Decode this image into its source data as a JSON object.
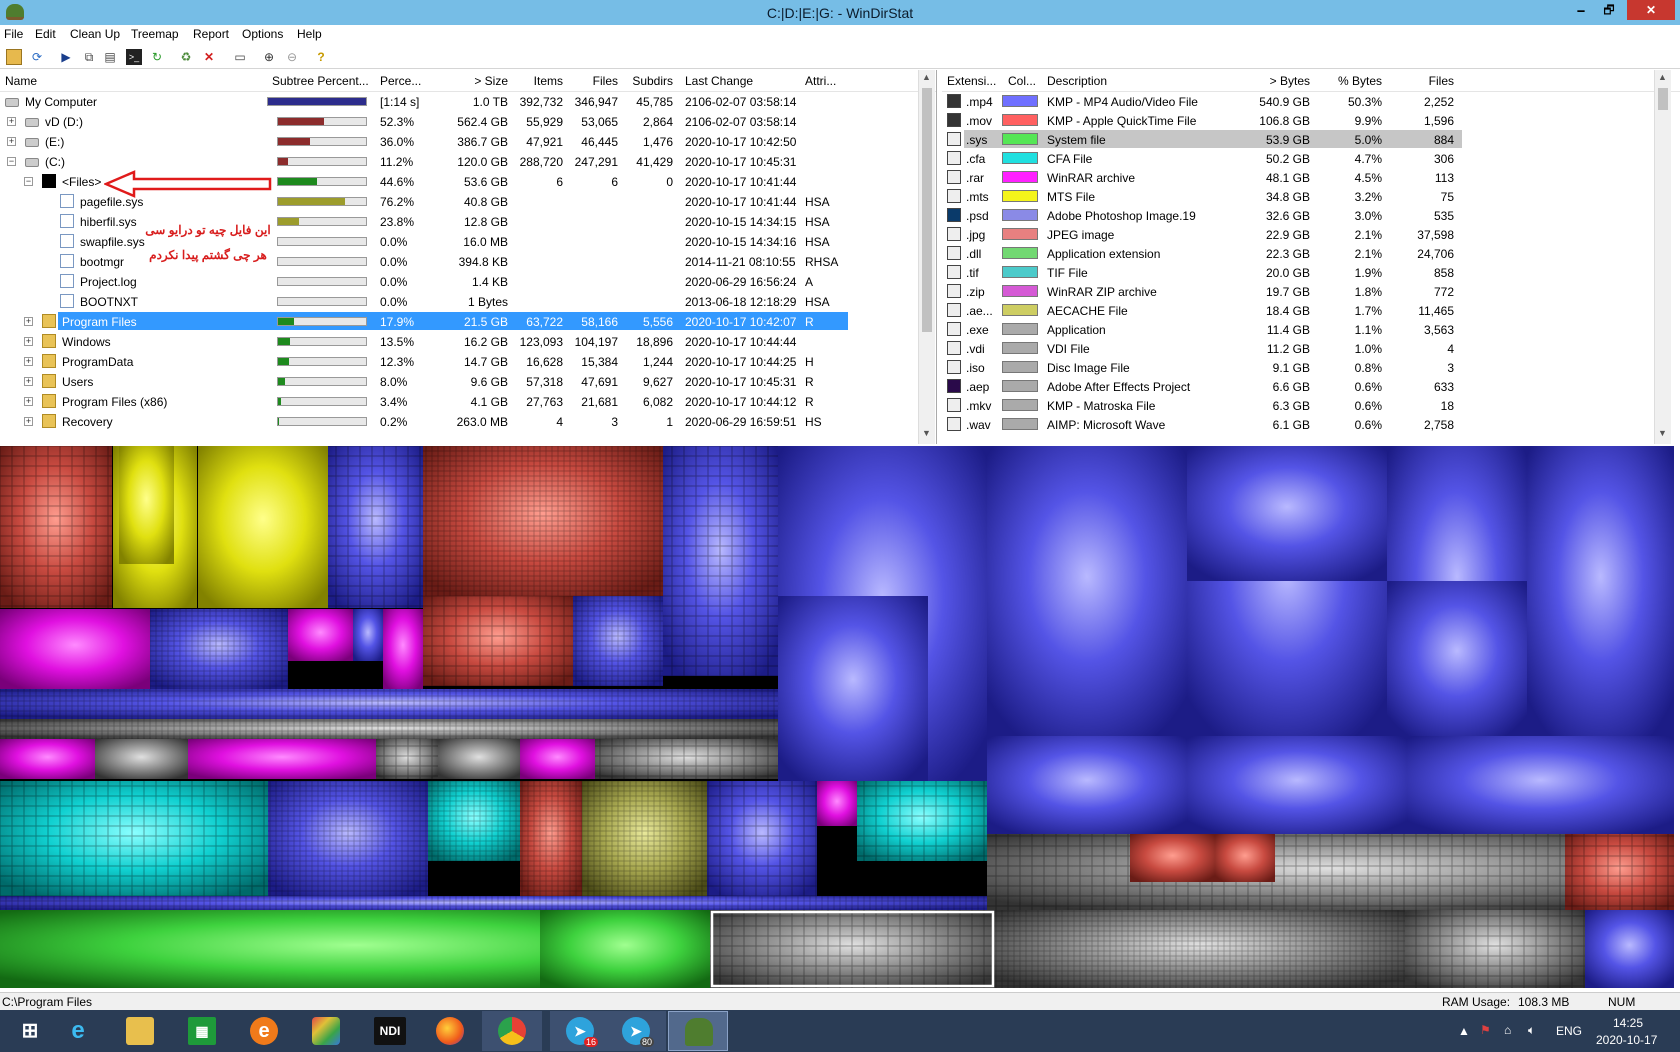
{
  "window": {
    "title": "C:|D:|E:|G: - WinDirStat",
    "min": "🗕",
    "max": "🗗",
    "close": "✕"
  },
  "menu": [
    "File",
    "Edit",
    "Clean Up",
    "Treemap",
    "Report",
    "Options",
    "Help"
  ],
  "tree": {
    "columns": [
      "Name",
      "Subtree Percent...",
      "Perce...",
      "> Size",
      "Items",
      "Files",
      "Subdirs",
      "Last Change",
      "Attri..."
    ],
    "rows": [
      {
        "name": "My Computer",
        "bar": 1.0,
        "pct": "[1:14 s]",
        "size": "1.0 TB",
        "items": "392,732",
        "files": "346,947",
        "subdirs": "45,785",
        "last": "2106-02-07 03:58:14",
        "attr": ""
      },
      {
        "name": "vD (D:)",
        "bar": 0.523,
        "pct": "52.3%",
        "size": "562.4 GB",
        "items": "55,929",
        "files": "53,065",
        "subdirs": "2,864",
        "last": "2106-02-07 03:58:14",
        "attr": ""
      },
      {
        "name": "(E:)",
        "bar": 0.36,
        "pct": "36.0%",
        "size": "386.7 GB",
        "items": "47,921",
        "files": "46,445",
        "subdirs": "1,476",
        "last": "2020-10-17 10:42:50",
        "attr": ""
      },
      {
        "name": "(C:)",
        "bar": 0.112,
        "pct": "11.2%",
        "size": "120.0 GB",
        "items": "288,720",
        "files": "247,291",
        "subdirs": "41,429",
        "last": "2020-10-17 10:45:31",
        "attr": ""
      },
      {
        "name": "<Files>",
        "bar": 0.446,
        "pct": "44.6%",
        "size": "53.6 GB",
        "items": "6",
        "files": "6",
        "subdirs": "0",
        "last": "2020-10-17 10:41:44",
        "attr": ""
      },
      {
        "name": "pagefile.sys",
        "bar": 0.762,
        "pct": "76.2%",
        "size": "40.8 GB",
        "items": "",
        "files": "",
        "subdirs": "",
        "last": "2020-10-17 10:41:44",
        "attr": "HSA"
      },
      {
        "name": "hiberfil.sys",
        "bar": 0.238,
        "pct": "23.8%",
        "size": "12.8 GB",
        "items": "",
        "files": "",
        "subdirs": "",
        "last": "2020-10-15 14:34:15",
        "attr": "HSA"
      },
      {
        "name": "swapfile.sys",
        "bar": 0.0,
        "pct": "0.0%",
        "size": "16.0 MB",
        "items": "",
        "files": "",
        "subdirs": "",
        "last": "2020-10-15 14:34:16",
        "attr": "HSA"
      },
      {
        "name": "bootmgr",
        "bar": 0.0,
        "pct": "0.0%",
        "size": "394.8 KB",
        "items": "",
        "files": "",
        "subdirs": "",
        "last": "2014-11-21 08:10:55",
        "attr": "RHSA"
      },
      {
        "name": "Project.log",
        "bar": 0.0,
        "pct": "0.0%",
        "size": "1.4 KB",
        "items": "",
        "files": "",
        "subdirs": "",
        "last": "2020-06-29 16:56:24",
        "attr": "A"
      },
      {
        "name": "BOOTNXT",
        "bar": 0.0,
        "pct": "0.0%",
        "size": "1 Bytes",
        "items": "",
        "files": "",
        "subdirs": "",
        "last": "2013-06-18 12:18:29",
        "attr": "HSA"
      },
      {
        "name": "Program Files",
        "bar": 0.179,
        "pct": "17.9%",
        "size": "21.5 GB",
        "items": "63,722",
        "files": "58,166",
        "subdirs": "5,556",
        "last": "2020-10-17 10:42:07",
        "attr": "R"
      },
      {
        "name": "Windows",
        "bar": 0.135,
        "pct": "13.5%",
        "size": "16.2 GB",
        "items": "123,093",
        "files": "104,197",
        "subdirs": "18,896",
        "last": "2020-10-17 10:44:44",
        "attr": ""
      },
      {
        "name": "ProgramData",
        "bar": 0.123,
        "pct": "12.3%",
        "size": "14.7 GB",
        "items": "16,628",
        "files": "15,384",
        "subdirs": "1,244",
        "last": "2020-10-17 10:44:25",
        "attr": "H"
      },
      {
        "name": "Users",
        "bar": 0.08,
        "pct": "8.0%",
        "size": "9.6 GB",
        "items": "57,318",
        "files": "47,691",
        "subdirs": "9,627",
        "last": "2020-10-17 10:45:31",
        "attr": "R"
      },
      {
        "name": "Program Files (x86)",
        "bar": 0.034,
        "pct": "3.4%",
        "size": "4.1 GB",
        "items": "27,763",
        "files": "21,681",
        "subdirs": "6,082",
        "last": "2020-10-17 10:44:12",
        "attr": "R"
      },
      {
        "name": "Recovery",
        "bar": 0.002,
        "pct": "0.2%",
        "size": "263.0 MB",
        "items": "4",
        "files": "3",
        "subdirs": "1",
        "last": "2020-06-29 16:59:51",
        "attr": "HS"
      }
    ]
  },
  "annotation": {
    "line1": "این فایل چیه تو درایو سی",
    "line2": "هر چی گشتم پیدا نکردم"
  },
  "extensions": {
    "columns": [
      "Extensi...",
      "Col...",
      "Description",
      "> Bytes",
      "% Bytes",
      "Files"
    ],
    "rows": [
      {
        "ext": ".mp4",
        "color": "#6f6fff",
        "desc": "KMP - MP4 Audio/Video File",
        "bytes": "540.9 GB",
        "pct": "50.3%",
        "files": "2,252"
      },
      {
        "ext": ".mov",
        "color": "#ff6060",
        "desc": "KMP - Apple QuickTime File",
        "bytes": "106.8 GB",
        "pct": "9.9%",
        "files": "1,596"
      },
      {
        "ext": ".sys",
        "color": "#55e655",
        "desc": "System file",
        "bytes": "53.9 GB",
        "pct": "5.0%",
        "files": "884"
      },
      {
        "ext": ".cfa",
        "color": "#20e0e0",
        "desc": "CFA File",
        "bytes": "50.2 GB",
        "pct": "4.7%",
        "files": "306"
      },
      {
        "ext": ".rar",
        "color": "#ff20ff",
        "desc": "WinRAR archive",
        "bytes": "48.1 GB",
        "pct": "4.5%",
        "files": "113"
      },
      {
        "ext": ".mts",
        "color": "#f5f51a",
        "desc": "MTS File",
        "bytes": "34.8 GB",
        "pct": "3.2%",
        "files": "75"
      },
      {
        "ext": ".psd",
        "color": "#8a8ae6",
        "desc": "Adobe Photoshop Image.19",
        "bytes": "32.6 GB",
        "pct": "3.0%",
        "files": "535"
      },
      {
        "ext": ".jpg",
        "color": "#e88080",
        "desc": "JPEG image",
        "bytes": "22.9 GB",
        "pct": "2.1%",
        "files": "37,598"
      },
      {
        "ext": ".dll",
        "color": "#72d872",
        "desc": "Application extension",
        "bytes": "22.3 GB",
        "pct": "2.1%",
        "files": "24,706"
      },
      {
        "ext": ".tif",
        "color": "#4ccaca",
        "desc": "TIF File",
        "bytes": "20.0 GB",
        "pct": "1.9%",
        "files": "858"
      },
      {
        "ext": ".zip",
        "color": "#d55ad5",
        "desc": "WinRAR ZIP archive",
        "bytes": "19.7 GB",
        "pct": "1.8%",
        "files": "772"
      },
      {
        "ext": ".ae...",
        "color": "#cdcd62",
        "desc": "AECACHE File",
        "bytes": "18.4 GB",
        "pct": "1.7%",
        "files": "11,465"
      },
      {
        "ext": ".exe",
        "color": "#aaaaaa",
        "desc": "Application",
        "bytes": "11.4 GB",
        "pct": "1.1%",
        "files": "3,563"
      },
      {
        "ext": ".vdi",
        "color": "#aaaaaa",
        "desc": "VDI File",
        "bytes": "11.2 GB",
        "pct": "1.0%",
        "files": "4"
      },
      {
        "ext": ".iso",
        "color": "#aaaaaa",
        "desc": "Disc Image File",
        "bytes": "9.1 GB",
        "pct": "0.8%",
        "files": "3"
      },
      {
        "ext": ".aep",
        "color": "#aaaaaa",
        "desc": "Adobe After Effects Project",
        "bytes": "6.6 GB",
        "pct": "0.6%",
        "files": "633"
      },
      {
        "ext": ".mkv",
        "color": "#aaaaaa",
        "desc": "KMP - Matroska File",
        "bytes": "6.3 GB",
        "pct": "0.6%",
        "files": "18"
      },
      {
        "ext": ".wav",
        "color": "#aaaaaa",
        "desc": "AIMP: Microsoft Wave",
        "bytes": "6.1 GB",
        "pct": "0.6%",
        "files": "2,758"
      }
    ]
  },
  "status": {
    "path": "C:\\Program Files",
    "ram_label": "RAM Usage:",
    "ram_value": "108.3 MB",
    "num": "NUM"
  },
  "taskbar": {
    "apps": [
      "windows-start",
      "internet-explorer",
      "file-explorer",
      "store",
      "edge",
      "bluestacks",
      "ndi",
      "firefox",
      "chrome",
      "telegram",
      "telegram-2",
      "windirstat"
    ],
    "ndi_label": "NDI",
    "badge_telegram": "16",
    "badge_telegram2": "80",
    "lang": "ENG",
    "time": "14:25",
    "date": "2020-10-17"
  }
}
